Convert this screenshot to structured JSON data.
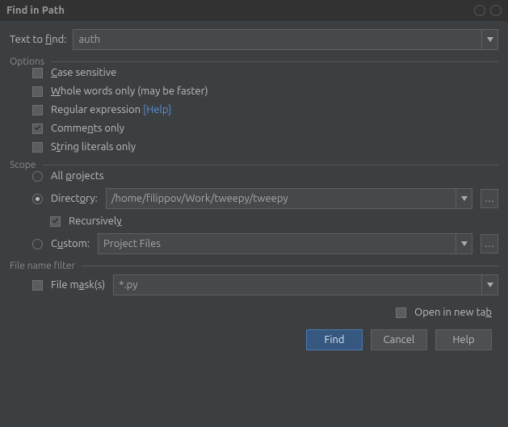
{
  "title": "Find in Path",
  "text_label_pre": "Text to ",
  "text_label_u": "f",
  "text_label_post": "ind:",
  "text_value": "auth",
  "options_label": "Options",
  "options": {
    "case_pre": "",
    "case_u": "C",
    "case_post": "ase sensitive",
    "whole_pre": "",
    "whole_u": "W",
    "whole_post": "hole words only (may be faster)",
    "regex_pre": "Re",
    "regex_u": "g",
    "regex_post": "ular expression",
    "help_link": "[Help]",
    "comments_pre": "Comme",
    "comments_u": "n",
    "comments_post": "ts only",
    "strings_pre": "S",
    "strings_u": "t",
    "strings_post": "ring literals only"
  },
  "scope_label": "Scope",
  "scope": {
    "all_pre": "All ",
    "all_u": "p",
    "all_post": "rojects",
    "dir_pre": "Direct",
    "dir_u": "o",
    "dir_post": "ry:",
    "dir_value": "/home/filippov/Work/tweepy/tweepy",
    "recurse_pre": "Recursivel",
    "recurse_u": "y",
    "recurse_post": "",
    "custom_pre": "C",
    "custom_u": "u",
    "custom_post": "stom:",
    "custom_value": "Project Files"
  },
  "filter_label": "File name filter",
  "filter": {
    "mask_pre": "File m",
    "mask_u": "a",
    "mask_post": "sk(s)",
    "mask_value": "*.py"
  },
  "open_tab_pre": "Open in new ta",
  "open_tab_u": "b",
  "buttons": {
    "find": "Find",
    "cancel": "Cancel",
    "help": "Help"
  }
}
